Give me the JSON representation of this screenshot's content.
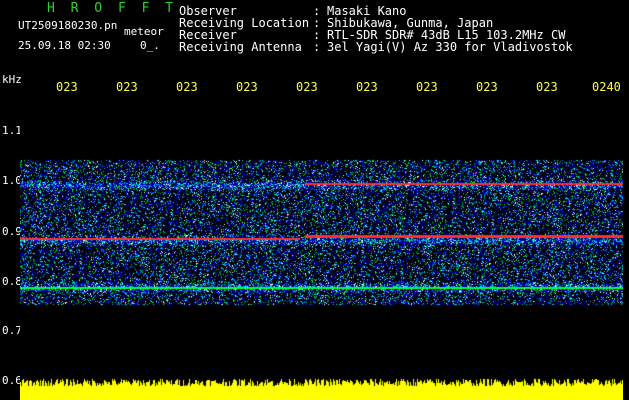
{
  "header": {
    "logo": "H R O F F T",
    "filename": "UT2509180230.pn",
    "mode": "meteor",
    "datetime": "25.09.18 02:30",
    "datetime_extra": "0_.",
    "rows": [
      {
        "label": "Observer",
        "value": "Masaki Kano"
      },
      {
        "label": "Receiving Location",
        "value": "Shibukawa, Gunma, Japan"
      },
      {
        "label": "Receiver",
        "value": "RTL-SDR SDR# 43dB L15 103.2MHz CW"
      },
      {
        "label": "Receiving Antenna",
        "value": "3el Yagi(V) Az 330 for Vladivostok"
      }
    ],
    "separator": ":"
  },
  "axes": {
    "y_unit": "kHz",
    "y_ticks": [
      "1.1",
      "1.0",
      "0.9",
      "0.8",
      "0.7",
      "0.6"
    ],
    "x_ticks": [
      "023",
      "023",
      "023",
      "023",
      "023",
      "023",
      "023",
      "023",
      "023",
      "0240"
    ]
  },
  "colors": {
    "background": "#000000",
    "logo": "#2fd12f",
    "text": "#ffffff",
    "time_labels": "#ffff3c",
    "signal_bar": "#ffff00",
    "noise_low": "#0000c8",
    "noise_mid": "#00c8ff",
    "noise_high": "#00ff40",
    "echo": "#ff3030"
  }
}
